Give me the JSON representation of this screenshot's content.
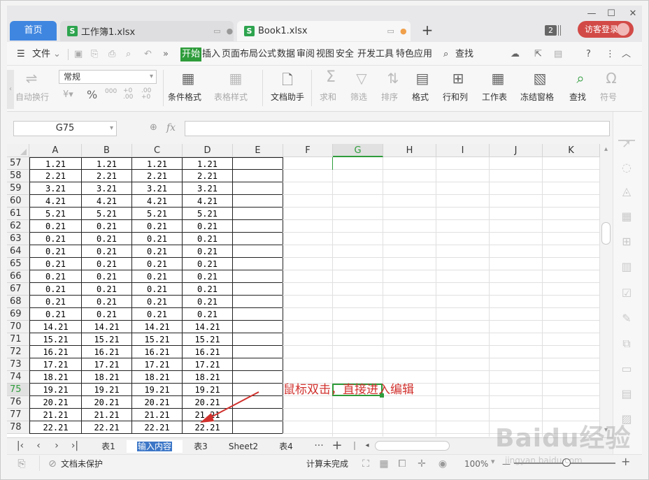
{
  "titlebar": {
    "home_tab": "首页",
    "tabs": [
      {
        "label": "工作簿1.xlsx",
        "icon": "S"
      },
      {
        "label": "Book1.xlsx",
        "icon": "S"
      }
    ],
    "new_tab": "+",
    "window_count": "2",
    "login_label": "访客登录"
  },
  "menubar": {
    "file_label": "文件",
    "items": [
      "开始",
      "插入",
      "页面布局",
      "公式",
      "数据",
      "审阅",
      "视图",
      "安全",
      "开发工具",
      "特色应用"
    ],
    "search_label": "查找",
    "more": "»",
    "help": "?"
  },
  "ribbon": {
    "autowrap": "自动换行",
    "style_value": "常规",
    "percent": "%",
    "thousands": "000",
    "inc_decimal": "+0 .00",
    "dec_decimal": ".00 +0",
    "conditional_format": "条件格式",
    "table_style": "表格样式",
    "doc_assistant": "文档助手",
    "sum": "求和",
    "filter": "筛选",
    "sort": "排序",
    "format": "格式",
    "row_col": "行和列",
    "worksheet": "工作表",
    "freeze": "冻结窗格",
    "find": "查找",
    "symbol": "符号"
  },
  "formula_bar": {
    "name_box": "G75",
    "fx": "fx",
    "value": ""
  },
  "grid": {
    "columns": [
      "A",
      "B",
      "C",
      "D",
      "E",
      "F",
      "G",
      "H",
      "I",
      "J",
      "K"
    ],
    "selected_column": "G",
    "selected_row": "75",
    "rows": [
      {
        "n": "57",
        "v": "1.21"
      },
      {
        "n": "58",
        "v": "2.21"
      },
      {
        "n": "59",
        "v": "3.21"
      },
      {
        "n": "60",
        "v": "4.21"
      },
      {
        "n": "61",
        "v": "5.21"
      },
      {
        "n": "62",
        "v": "0.21"
      },
      {
        "n": "63",
        "v": "0.21"
      },
      {
        "n": "64",
        "v": "0.21"
      },
      {
        "n": "65",
        "v": "0.21"
      },
      {
        "n": "66",
        "v": "0.21"
      },
      {
        "n": "67",
        "v": "0.21"
      },
      {
        "n": "68",
        "v": "0.21"
      },
      {
        "n": "69",
        "v": "0.21"
      },
      {
        "n": "70",
        "v": "14.21"
      },
      {
        "n": "71",
        "v": "15.21"
      },
      {
        "n": "72",
        "v": "16.21"
      },
      {
        "n": "73",
        "v": "17.21"
      },
      {
        "n": "74",
        "v": "18.21"
      },
      {
        "n": "75",
        "v": "19.21"
      },
      {
        "n": "76",
        "v": "20.21"
      },
      {
        "n": "77",
        "v": "21.21"
      },
      {
        "n": "78",
        "v": "22.21"
      }
    ],
    "annotation": "鼠标双击，直接进入编辑"
  },
  "sheet_tabs": {
    "tabs": [
      "表1",
      "输入内容",
      "表3",
      "Sheet2",
      "表4"
    ],
    "active": "输入内容",
    "more": "···",
    "add": "+"
  },
  "statusbar": {
    "protect": "文档未保护",
    "calc": "计算未完成",
    "zoom": "100%",
    "zoom_minus": "—",
    "zoom_plus": "+"
  },
  "watermark": {
    "main": "Baidu经验",
    "sub": "jingyan.baidu.com"
  },
  "colors": {
    "accent": "#2e9c3b",
    "home_tab": "#3f86e0",
    "login": "#d24a47",
    "annotation": "#d0312d"
  }
}
